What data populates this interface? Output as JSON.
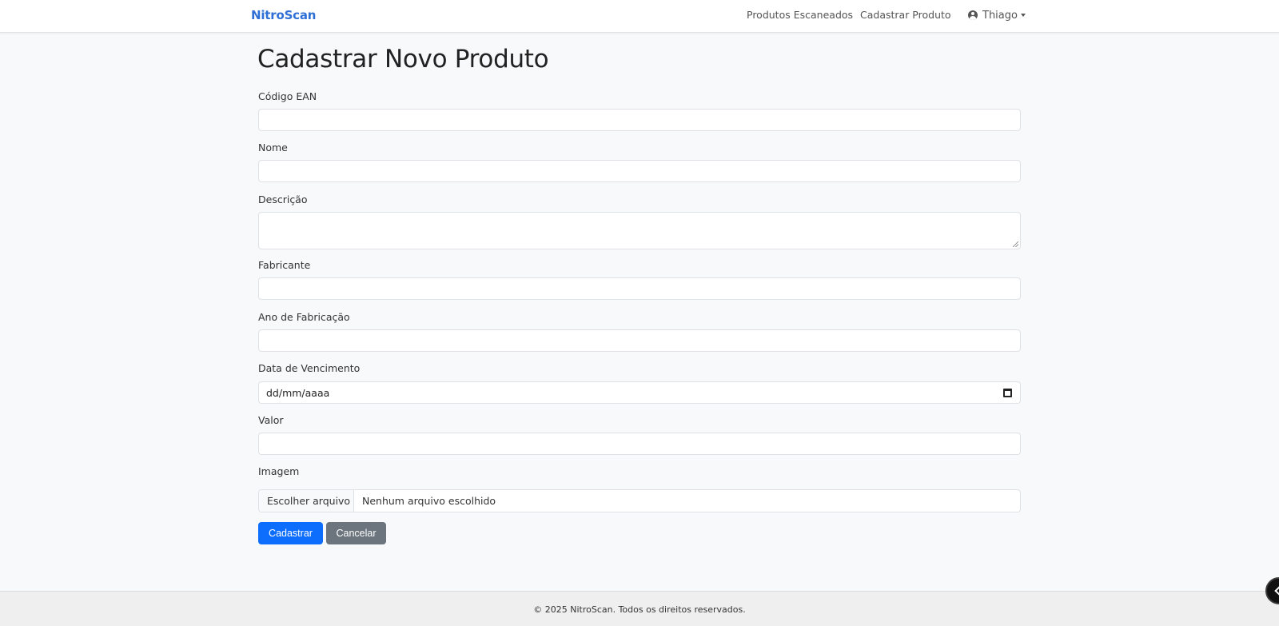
{
  "navbar": {
    "brand": "NitroScan",
    "links": [
      "Produtos Escaneados",
      "Cadastrar Produto"
    ],
    "user_name": "Thiago"
  },
  "page": {
    "title": "Cadastrar Novo Produto"
  },
  "form": {
    "ean_label": "Código EAN",
    "ean_value": "",
    "nome_label": "Nome",
    "nome_value": "",
    "descricao_label": "Descrição",
    "descricao_value": "",
    "fabricante_label": "Fabricante",
    "fabricante_value": "",
    "ano_label": "Ano de Fabricação",
    "ano_value": "",
    "vencimento_label": "Data de Vencimento",
    "vencimento_placeholder": "dd/mm/aaaa",
    "valor_label": "Valor",
    "valor_value": "",
    "imagem_label": "Imagem",
    "file_button_label": "Escolher arquivo",
    "file_status": "Nenhum arquivo escolhido",
    "submit_label": "Cadastrar",
    "cancel_label": "Cancelar"
  },
  "footer": {
    "text": "© 2025 NitroScan. Todos os direitos reservados."
  },
  "colors": {
    "brand": "#2f6fd6",
    "primary": "#0d6efd",
    "secondary": "#6c757d",
    "background": "#f8f9fa"
  }
}
